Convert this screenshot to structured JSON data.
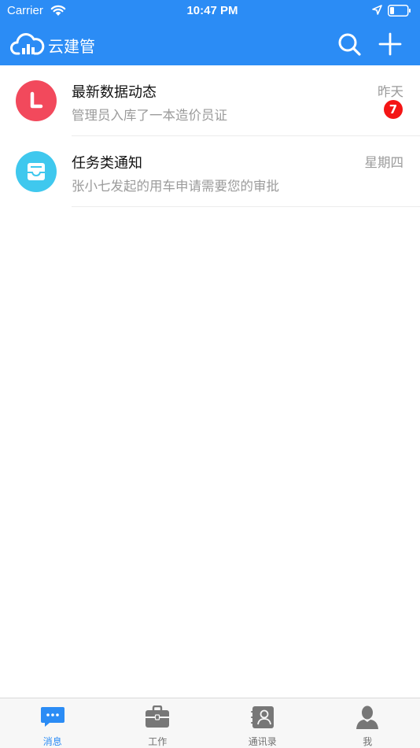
{
  "status_bar": {
    "carrier": "Carrier",
    "time": "10:47 PM"
  },
  "header": {
    "app_title": "云建管"
  },
  "conversations": [
    {
      "title": "最新数据动态",
      "preview": "管理员入库了一本造价员证",
      "time": "昨天",
      "badge": "7",
      "avatar_color": "#f2495c",
      "icon": "clock-icon"
    },
    {
      "title": "任务类通知",
      "preview": "张小七发起的用车申请需要您的审批",
      "time": "星期四",
      "avatar_color": "#3fc8ee",
      "icon": "inbox-icon"
    }
  ],
  "tabs": [
    {
      "label": "消息",
      "icon": "chat-icon",
      "active": true
    },
    {
      "label": "工作",
      "icon": "briefcase-icon",
      "active": false
    },
    {
      "label": "通讯录",
      "icon": "contacts-icon",
      "active": false
    },
    {
      "label": "我",
      "icon": "person-icon",
      "active": false
    }
  ],
  "colors": {
    "primary": "#2b8cf5",
    "badge": "#f41515",
    "tab_inactive": "#707070"
  }
}
